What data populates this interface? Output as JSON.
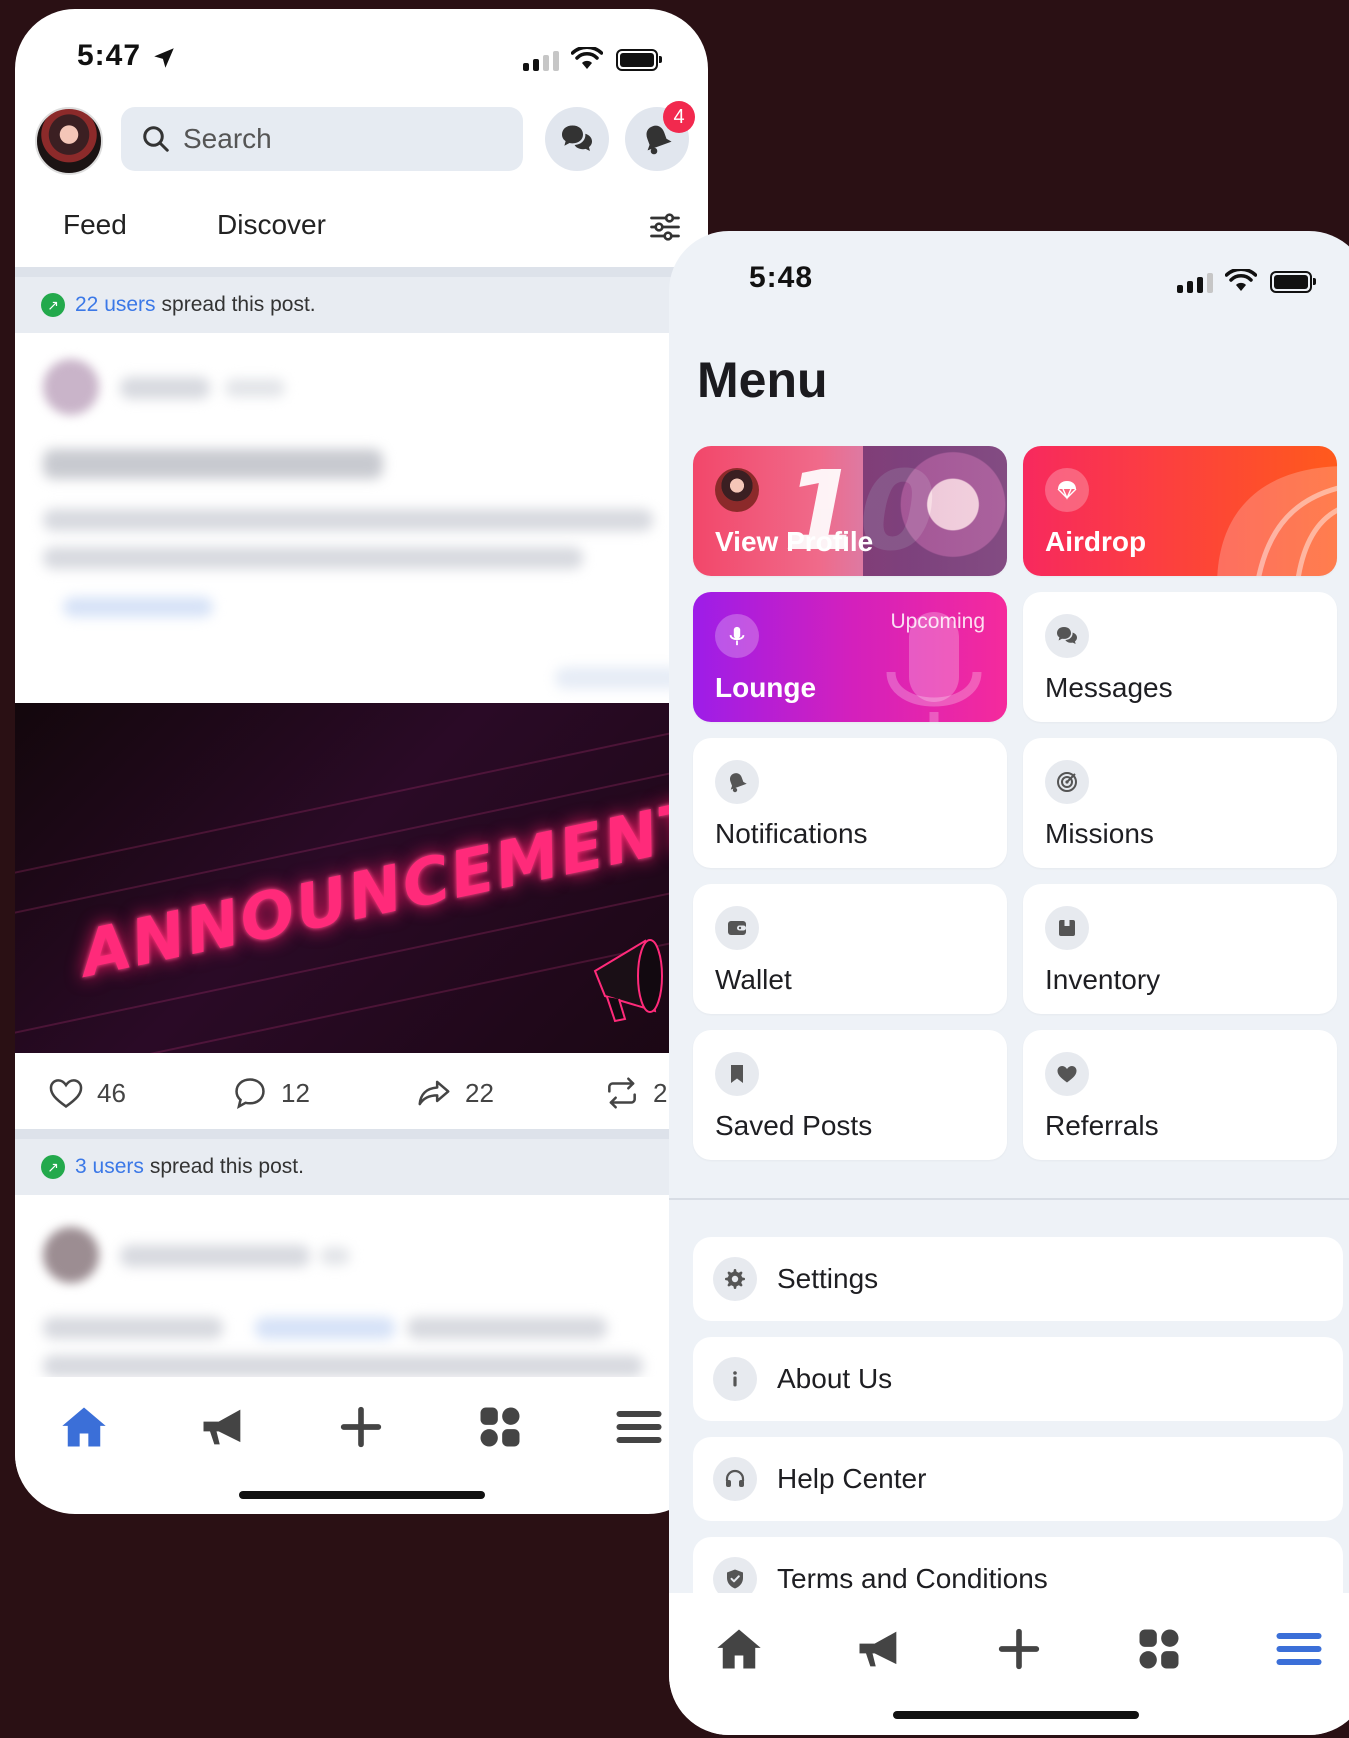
{
  "left": {
    "status": {
      "time": "5:47"
    },
    "search": {
      "placeholder": "Search"
    },
    "notifications_badge": "4",
    "tabs": [
      {
        "label": "Feed"
      },
      {
        "label": "Discover"
      }
    ],
    "spread1": {
      "count": "22 users",
      "text": "spread this post."
    },
    "announcement": "ANNOUNCEMENT",
    "actions": {
      "likes": "46",
      "comments": "12",
      "shares": "22",
      "reposts": "2"
    },
    "spread2": {
      "count": "3 users",
      "text": "spread this post."
    }
  },
  "right": {
    "status": {
      "time": "5:48"
    },
    "title": "Menu",
    "tiles": [
      {
        "label": "View Profile"
      },
      {
        "label": "Airdrop"
      },
      {
        "label": "Lounge",
        "tag": "Upcoming"
      },
      {
        "label": "Messages"
      },
      {
        "label": "Notifications"
      },
      {
        "label": "Missions"
      },
      {
        "label": "Wallet"
      },
      {
        "label": "Inventory"
      },
      {
        "label": "Saved Posts"
      },
      {
        "label": "Referrals"
      }
    ],
    "rows": [
      {
        "label": "Settings"
      },
      {
        "label": "About Us"
      },
      {
        "label": "Help Center"
      },
      {
        "label": "Terms and Conditions"
      }
    ]
  },
  "colors": {
    "accent": "#3b6fd8",
    "badge": "#f2294e",
    "spread_icon": "#23a94c",
    "link": "#3b78e7"
  },
  "icons": [
    "location-arrow-icon",
    "signal-icon",
    "wifi-icon",
    "battery-icon",
    "search-icon",
    "chat-icon",
    "bell-icon",
    "filter-icon",
    "heart-icon",
    "comment-icon",
    "share-icon",
    "repost-icon",
    "home-icon",
    "megaphone-icon",
    "plus-icon",
    "apps-icon",
    "hamburger-icon",
    "parachute-icon",
    "microphone-icon",
    "target-icon",
    "wallet-icon",
    "box-icon",
    "bookmark-icon",
    "gear-icon",
    "info-icon",
    "headset-icon",
    "shield-icon"
  ]
}
